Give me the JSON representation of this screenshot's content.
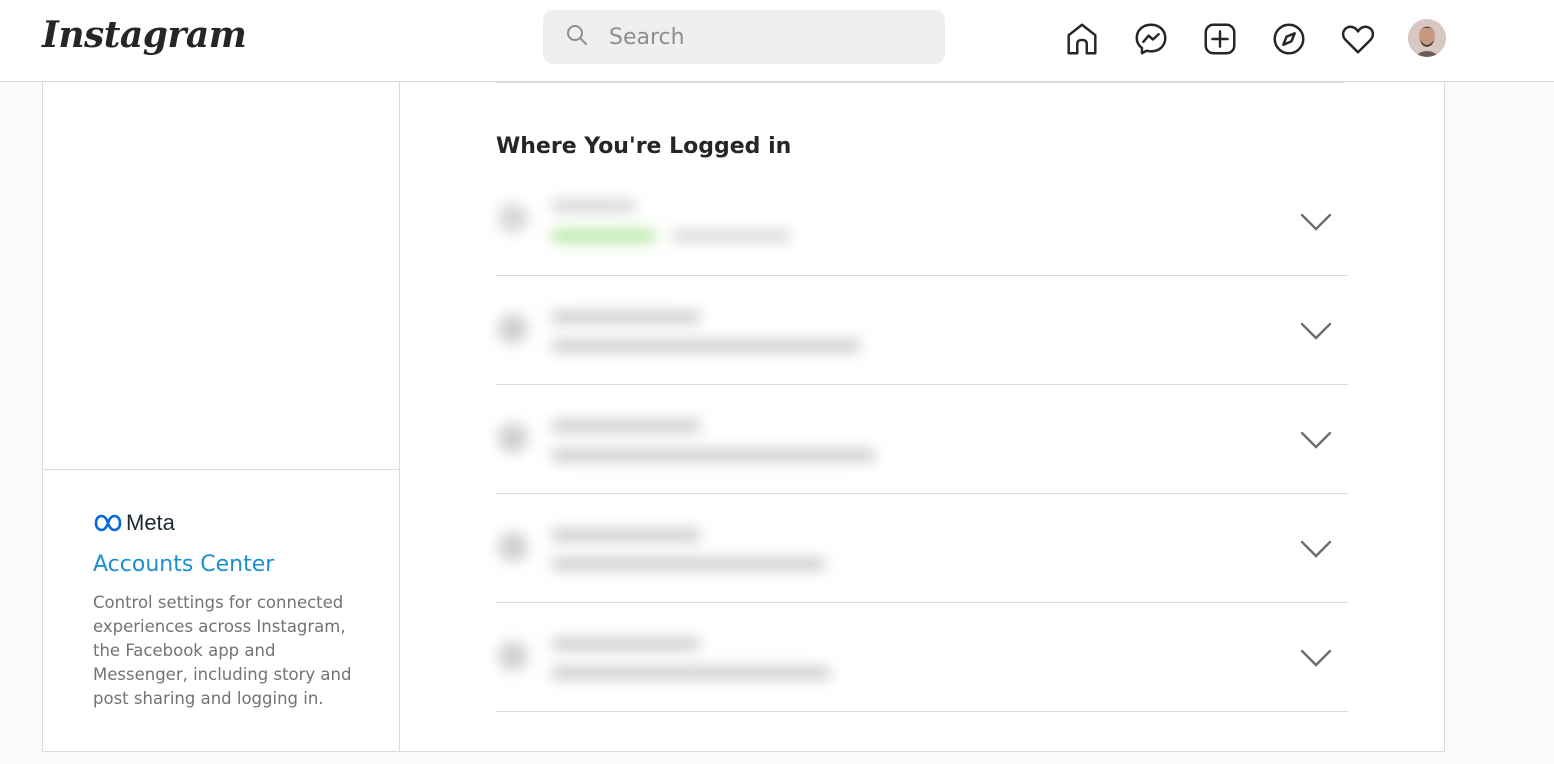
{
  "header": {
    "logo_text": "Instagram",
    "search_placeholder": "Search",
    "nav_icons": [
      "home-icon",
      "messenger-icon",
      "new-post-icon",
      "explore-icon",
      "activity-heart-icon"
    ],
    "avatar": "profile-avatar"
  },
  "sidebar": {
    "meta_label": "Meta",
    "accounts_center_label": "Accounts Center",
    "accounts_center_description": "Control settings for connected experiences across Instagram, the Facebook app and Messenger, including story and post sharing and logging in."
  },
  "main": {
    "section_title": "Where You're Logged in",
    "sessions_count_visible": 5,
    "session_details_note": "blurred"
  },
  "colors": {
    "accent_link": "#1a8fd6",
    "active_status": "#7ed957",
    "divider": "#dbdbdb"
  }
}
